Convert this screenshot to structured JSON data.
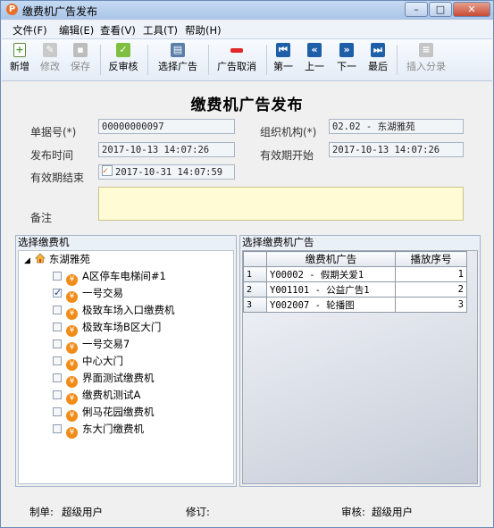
{
  "window": {
    "title": "缴费机广告发布"
  },
  "menu": [
    "文件(F)",
    "编辑(E)",
    "查看(V)",
    "工具(T)",
    "帮助(H)"
  ],
  "toolbar": {
    "new": "新增",
    "edit": "修改",
    "save": "保存",
    "unaudit": "反审核",
    "select_ad": "选择广告",
    "cancel_ad": "广告取消",
    "first": "第一",
    "prev": "上一",
    "next": "下一",
    "last": "最后",
    "insert_split": "插入分录"
  },
  "form": {
    "title": "缴费机广告发布",
    "doc_no_label": "单据号(*)",
    "doc_no": "00000000097",
    "org_label": "组织机构(*)",
    "org": "02.02 - 东湖雅苑",
    "publish_time_label": "发布时间",
    "publish_time": "2017-10-13 14:07:26",
    "valid_start_label": "有效期开始",
    "valid_start": "2017-10-13 14:07:26",
    "valid_end_label": "有效期结束",
    "valid_end": "2017-10-31 14:07:59",
    "remark_label": "备注"
  },
  "machine_panel": {
    "title": "选择缴费机",
    "root": "东湖雅苑",
    "items": [
      {
        "label": "A区停车电梯间#1",
        "checked": false
      },
      {
        "label": "一号交易",
        "checked": true
      },
      {
        "label": "极致车场入口缴费机",
        "checked": false
      },
      {
        "label": "极致车场B区大门",
        "checked": false
      },
      {
        "label": "一号交易7",
        "checked": false
      },
      {
        "label": "中心大门",
        "checked": false
      },
      {
        "label": "界面测试缴费机",
        "checked": false
      },
      {
        "label": "缴费机测试A",
        "checked": false
      },
      {
        "label": "俐马花园缴费机",
        "checked": false
      },
      {
        "label": "东大门缴费机",
        "checked": false
      }
    ]
  },
  "ad_panel": {
    "title": "选择缴费机广告",
    "col_ad": "缴费机广告",
    "col_order": "播放序号",
    "rows": [
      {
        "n": "1",
        "ad": "Y00002 - 假期关爱1",
        "order": "1"
      },
      {
        "n": "2",
        "ad": "Y001101 - 公益广告1",
        "order": "2"
      },
      {
        "n": "3",
        "ad": "Y002007 - 轮播图",
        "order": "3"
      }
    ]
  },
  "footer": {
    "maker_label": "制单:",
    "maker": "超级用户",
    "revise_label": "修订:",
    "audit_label": "审核:",
    "auditor": "超级用户"
  },
  "colors": {
    "accent": "#f28b17",
    "remark_bg": "#fffbd4",
    "titlebar": "#b4cdea"
  }
}
